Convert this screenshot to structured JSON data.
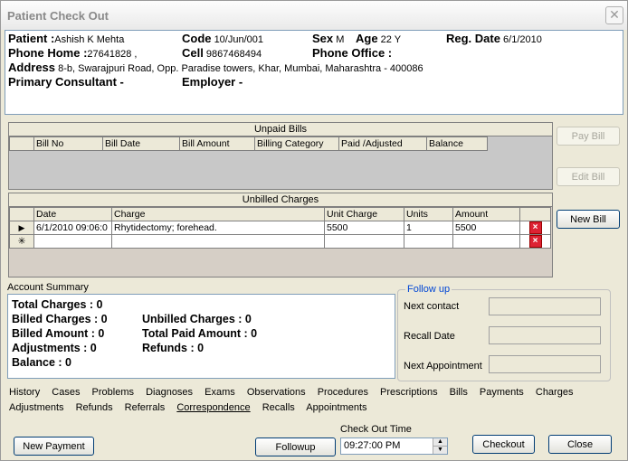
{
  "window": {
    "title": "Patient Check Out",
    "close": "✕"
  },
  "patient": {
    "patient_label": "Patient :",
    "patient_value": "Ashish  K  Mehta",
    "code_label": "Code",
    "code_value": "10/Jun/001",
    "sex_label": "Sex",
    "sex_value": "M",
    "age_label": "Age",
    "age_value": "22 Y",
    "reg_label": "Reg. Date",
    "reg_value": "6/1/2010",
    "phone_home_label": "Phone Home :",
    "phone_home_value": "27641828 ,",
    "cell_label": "Cell",
    "cell_value": "9867468494",
    "phone_office_label": "Phone Office :",
    "address_label": "Address",
    "address_value": "8-b, Swarajpuri Road, Opp. Paradise towers, Khar, Mumbai, Maharashtra - 400086",
    "consultant_label": "Primary Consultant -",
    "employer_label": "Employer -"
  },
  "unpaid_bills": {
    "caption": "Unpaid Bills",
    "columns": [
      "Bill No",
      "Bill  Date",
      "Bill Amount",
      "Billing Category",
      "Paid /Adjusted",
      "Balance"
    ]
  },
  "unbilled": {
    "caption": "Unbilled Charges",
    "columns": [
      "Date",
      "Charge",
      "Unit Charge",
      "Units",
      "Amount"
    ],
    "row": {
      "date": "6/1/2010 09:06:0",
      "charge": "Rhytidectomy; forehead.",
      "unit_charge": "5500",
      "units": "1",
      "amount": "5500"
    },
    "row_marker": "▶",
    "new_marker": "✳"
  },
  "buttons": {
    "pay_bill": "Pay Bill",
    "edit_bill": "Edit Bill",
    "new_bill": "New Bill",
    "new_payment": "New Payment",
    "followup": "Followup",
    "checkout": "Checkout",
    "close": "Close"
  },
  "summary": {
    "title": "Account Summary",
    "total_charges": "Total Charges : 0",
    "billed_charges": "Billed Charges : 0",
    "billed_amount": "Billed Amount : 0",
    "adjustments": "Adjustments : 0",
    "balance": "Balance  : 0",
    "unbilled_charges": "Unbilled Charges : 0",
    "total_paid": "Total Paid Amount : 0",
    "refunds": "Refunds : 0"
  },
  "followup": {
    "legend": "Follow up",
    "next_contact": "Next contact",
    "recall_date": "Recall Date",
    "next_appointment": "Next Appointment"
  },
  "links_row1": [
    "History",
    "Cases",
    "Problems",
    "Diagnoses",
    "Exams",
    "Observations",
    "Procedures",
    "Prescriptions",
    "Bills",
    "Payments",
    "Charges"
  ],
  "links_row2": [
    "Adjustments",
    "Refunds",
    "Referrals",
    "Correspondence",
    "Recalls",
    "Appointments"
  ],
  "checkout_time": {
    "label": "Check Out Time",
    "value": "09:27:00 PM"
  }
}
